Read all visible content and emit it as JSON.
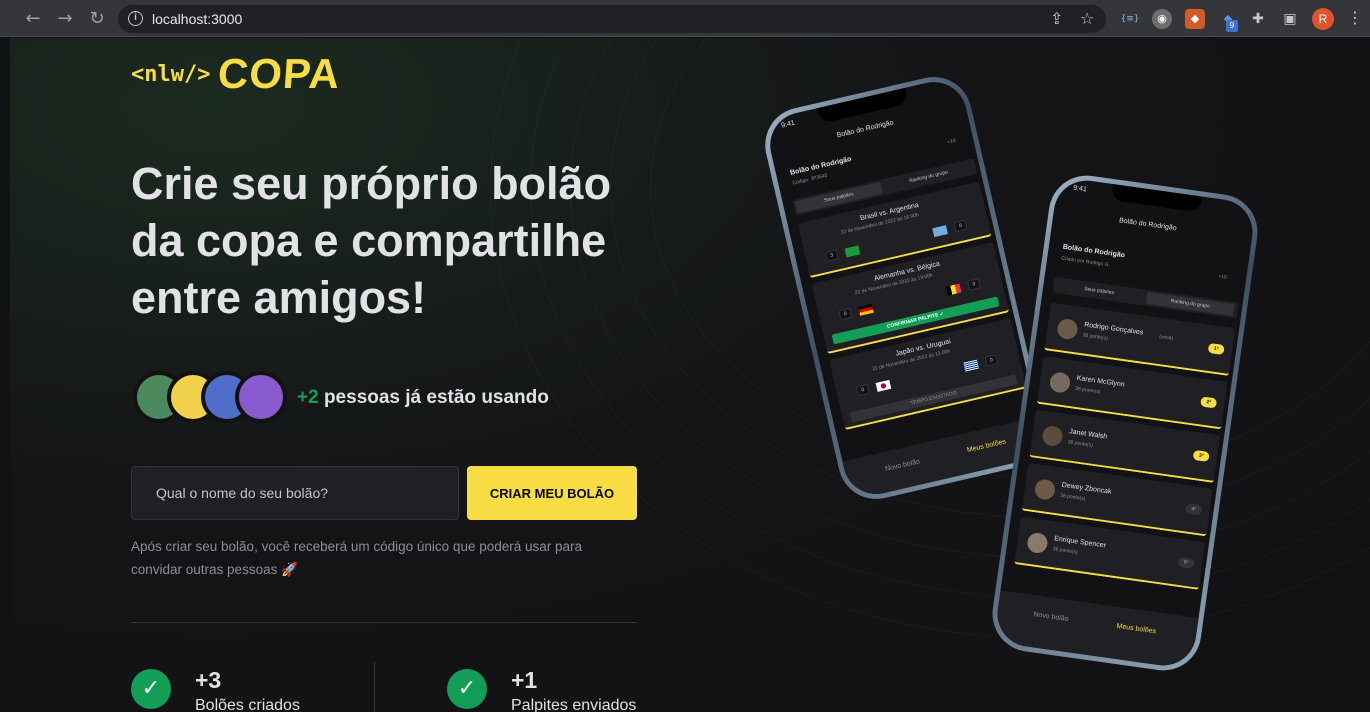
{
  "browser": {
    "url": "localhost:3000",
    "extension_badge": "9",
    "profile_initial": "R"
  },
  "logo": {
    "prefix": "<nlw/>",
    "name": "COPA"
  },
  "hero": {
    "headline": "Crie seu próprio bolão da copa e compartilhe entre amigos!",
    "users_count": "+2",
    "users_text": " pessoas já estão usando"
  },
  "form": {
    "input_placeholder": "Qual o nome do seu bolão?",
    "submit_label": "CRIAR MEU BOLÃO",
    "hint": "Após criar seu bolão, você receberá um código único que poderá usar para convidar outras pessoas 🚀"
  },
  "stats": [
    {
      "value": "+3",
      "label": "Bolões criados"
    },
    {
      "value": "+1",
      "label": "Palpites enviados"
    }
  ],
  "phone_back": {
    "time": "9:41",
    "title": "Bolão do Rodrigão",
    "pool_name": "Bolão do Rodrigão",
    "pool_code": "Código: JP3640",
    "participants_extra": "+10",
    "tabs": [
      "Seus palpites",
      "Ranking do grupo"
    ],
    "games": [
      {
        "teams": "Brasil vs. Argentina",
        "date": "22 de Novembro de 2022 às 16:00h",
        "score1": "3",
        "score2": "0"
      },
      {
        "teams": "Alemanha vs. Bélgica",
        "date": "22 de Novembro de 2022 às 19:00h",
        "score1": "0",
        "score2": "0",
        "button": "CONFIRMAR PALPITE ✓"
      },
      {
        "teams": "Japão vs. Uruguai",
        "date": "22 de Novembro de 2022 às 12:00h",
        "score1": "0",
        "score2": "0",
        "button": "TEMPO ESGOTADO"
      }
    ],
    "nav": [
      "Novo bolão",
      "Meus bolões"
    ]
  },
  "phone_front": {
    "time": "9:41",
    "title": "Bolão do Rodrigão",
    "pool_name": "Bolão do Rodrigão",
    "pool_creator": "Criado por Rodrigo G.",
    "participants_extra": "+10",
    "tabs": [
      "Seus palpites",
      "Ranking do grupo"
    ],
    "ranking": [
      {
        "name": "Rodrigo Gonçalves",
        "tag": "(você)",
        "points": "36 ponto(s)",
        "rank": "1º"
      },
      {
        "name": "Karen McGlynn",
        "tag": "",
        "points": "36 ponto(s)",
        "rank": "2º"
      },
      {
        "name": "Janet Walsh",
        "tag": "",
        "points": "36 ponto(s)",
        "rank": "3º"
      },
      {
        "name": "Dewey Zboncak",
        "tag": "",
        "points": "36 ponto(s)",
        "rank": "4º"
      },
      {
        "name": "Enrique Spencer",
        "tag": "",
        "points": "36 ponto(s)",
        "rank": "5º"
      }
    ],
    "nav": [
      "Novo bolão",
      "Meus bolões"
    ]
  },
  "colors": {
    "accent_yellow": "#f7dd43",
    "accent_green": "#129e57",
    "background": "#121214"
  }
}
